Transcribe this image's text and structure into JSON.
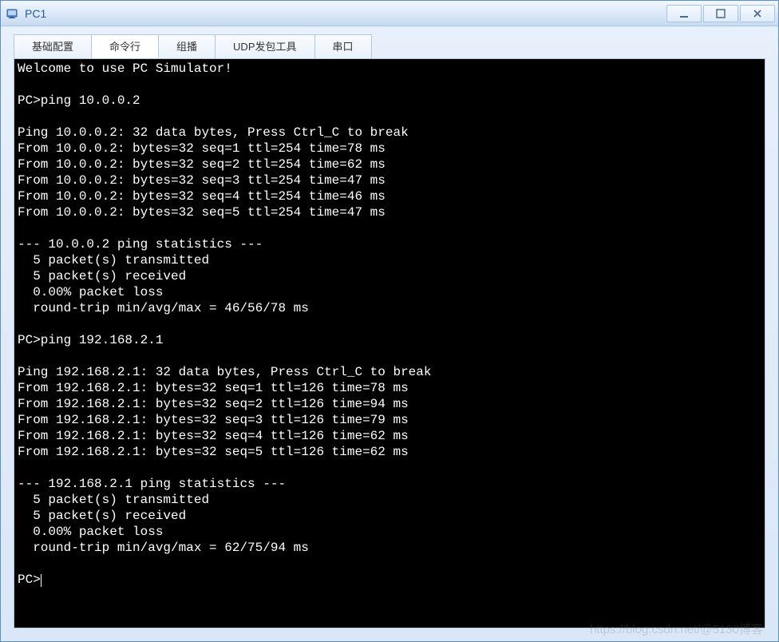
{
  "window": {
    "title": "PC1"
  },
  "tabs": [
    {
      "label": "基础配置",
      "active": false
    },
    {
      "label": "命令行",
      "active": true
    },
    {
      "label": "组播",
      "active": false
    },
    {
      "label": "UDP发包工具",
      "active": false
    },
    {
      "label": "串口",
      "active": false
    }
  ],
  "terminal": {
    "lines": [
      "Welcome to use PC Simulator!",
      "",
      "PC>ping 10.0.0.2",
      "",
      "Ping 10.0.0.2: 32 data bytes, Press Ctrl_C to break",
      "From 10.0.0.2: bytes=32 seq=1 ttl=254 time=78 ms",
      "From 10.0.0.2: bytes=32 seq=2 ttl=254 time=62 ms",
      "From 10.0.0.2: bytes=32 seq=3 ttl=254 time=47 ms",
      "From 10.0.0.2: bytes=32 seq=4 ttl=254 time=46 ms",
      "From 10.0.0.2: bytes=32 seq=5 ttl=254 time=47 ms",
      "",
      "--- 10.0.0.2 ping statistics ---",
      "  5 packet(s) transmitted",
      "  5 packet(s) received",
      "  0.00% packet loss",
      "  round-trip min/avg/max = 46/56/78 ms",
      "",
      "PC>ping 192.168.2.1",
      "",
      "Ping 192.168.2.1: 32 data bytes, Press Ctrl_C to break",
      "From 192.168.2.1: bytes=32 seq=1 ttl=126 time=78 ms",
      "From 192.168.2.1: bytes=32 seq=2 ttl=126 time=94 ms",
      "From 192.168.2.1: bytes=32 seq=3 ttl=126 time=79 ms",
      "From 192.168.2.1: bytes=32 seq=4 ttl=126 time=62 ms",
      "From 192.168.2.1: bytes=32 seq=5 ttl=126 time=62 ms",
      "",
      "--- 192.168.2.1 ping statistics ---",
      "  5 packet(s) transmitted",
      "  5 packet(s) received",
      "  0.00% packet loss",
      "  round-trip min/avg/max = 62/75/94 ms",
      ""
    ],
    "prompt": "PC>"
  },
  "watermark": "https://blog.csdn.net/@5130博客"
}
